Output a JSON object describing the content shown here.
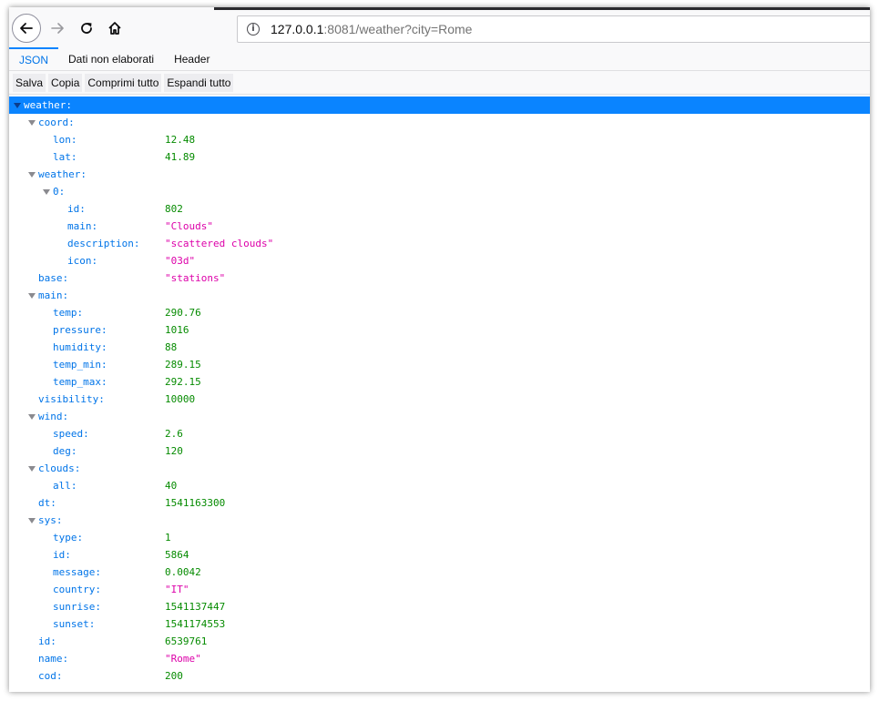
{
  "nav": {
    "url_host": "127.0.0.1",
    "url_rest": ":8081/weather?city=Rome"
  },
  "viewer_tabs": [
    "JSON",
    "Dati non elaborati",
    "Header"
  ],
  "toolbar": {
    "save": "Salva",
    "copy": "Copia",
    "collapse_all": "Comprimi tutto",
    "expand_all": "Espandi tutto"
  },
  "tree": {
    "root": "weather:",
    "coord": {
      "label": "coord:",
      "lon_k": "lon:",
      "lon_v": "12.48",
      "lat_k": "lat:",
      "lat_v": "41.89"
    },
    "weather": {
      "label": "weather:",
      "item0": "0:",
      "id_k": "id:",
      "id_v": "802",
      "main_k": "main:",
      "main_v": "\"Clouds\"",
      "desc_k": "description:",
      "desc_v": "\"scattered clouds\"",
      "icon_k": "icon:",
      "icon_v": "\"03d\""
    },
    "base_k": "base:",
    "base_v": "\"stations\"",
    "main": {
      "label": "main:",
      "temp_k": "temp:",
      "temp_v": "290.76",
      "pressure_k": "pressure:",
      "pressure_v": "1016",
      "humidity_k": "humidity:",
      "humidity_v": "88",
      "temp_min_k": "temp_min:",
      "temp_min_v": "289.15",
      "temp_max_k": "temp_max:",
      "temp_max_v": "292.15"
    },
    "visibility_k": "visibility:",
    "visibility_v": "10000",
    "wind": {
      "label": "wind:",
      "speed_k": "speed:",
      "speed_v": "2.6",
      "deg_k": "deg:",
      "deg_v": "120"
    },
    "clouds": {
      "label": "clouds:",
      "all_k": "all:",
      "all_v": "40"
    },
    "dt_k": "dt:",
    "dt_v": "1541163300",
    "sys": {
      "label": "sys:",
      "type_k": "type:",
      "type_v": "1",
      "id_k": "id:",
      "id_v": "5864",
      "message_k": "message:",
      "message_v": "0.0042",
      "country_k": "country:",
      "country_v": "\"IT\"",
      "sunrise_k": "sunrise:",
      "sunrise_v": "1541137447",
      "sunset_k": "sunset:",
      "sunset_v": "1541174553"
    },
    "id_k": "id:",
    "id_v": "6539761",
    "name_k": "name:",
    "name_v": "\"Rome\"",
    "cod_k": "cod:",
    "cod_v": "200"
  },
  "colors": {
    "key": "#0074e8",
    "number": "#058b00",
    "string": "#dd00a9",
    "selected": "#0a84ff"
  }
}
